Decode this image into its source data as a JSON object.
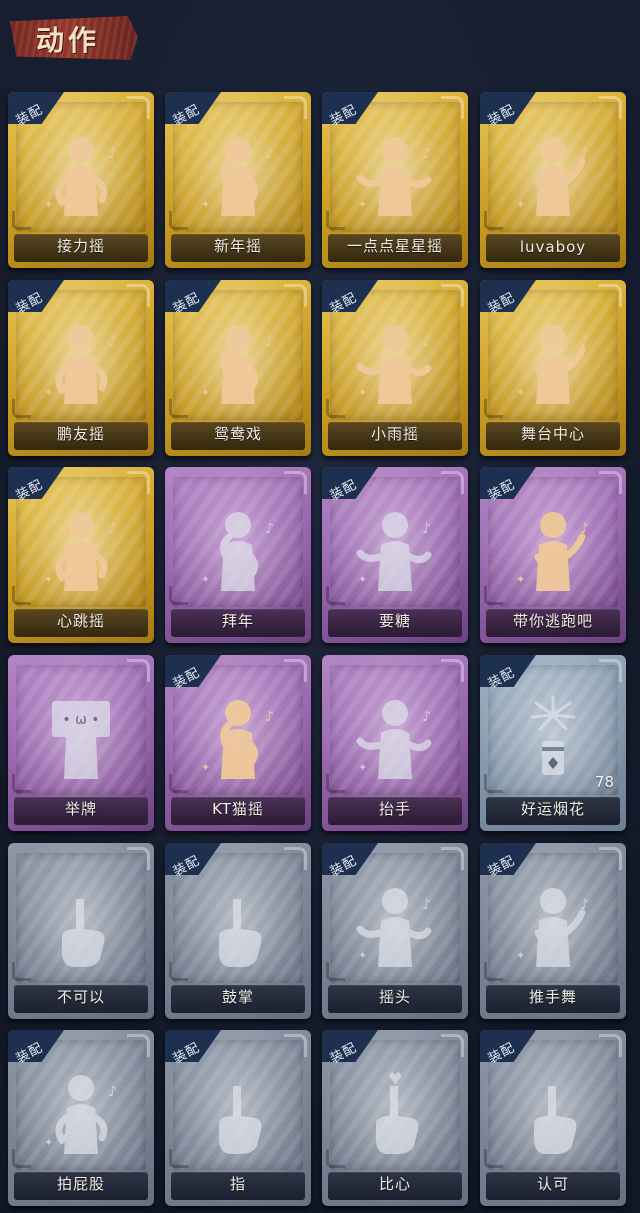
{
  "page": {
    "title": "动作"
  },
  "colors": {
    "gold": "#d4a930",
    "purple": "#9c6bb2",
    "silver": "#7b8596",
    "bluegray": "#8799ad",
    "equip_badge": "#1e3050",
    "figure_gold": "#f0c99a",
    "figure_faded": "#dfe3ea"
  },
  "equip_label": "装配",
  "cards": [
    {
      "label": "接力摇",
      "rarity": "gold",
      "equipped": true,
      "icon": "figure-dance-icon"
    },
    {
      "label": "新年摇",
      "rarity": "gold",
      "equipped": true,
      "icon": "figure-dance-icon"
    },
    {
      "label": "一点点星星摇",
      "rarity": "gold",
      "equipped": true,
      "icon": "figure-dance-icon"
    },
    {
      "label": "luvaboy",
      "rarity": "gold",
      "equipped": true,
      "icon": "figure-dance-icon"
    },
    {
      "label": "鹏友摇",
      "rarity": "gold",
      "equipped": true,
      "icon": "figure-dance-icon"
    },
    {
      "label": "鸳鸯戏",
      "rarity": "gold",
      "equipped": true,
      "icon": "figure-dance-icon"
    },
    {
      "label": "小雨摇",
      "rarity": "gold",
      "equipped": true,
      "icon": "figure-dance-icon"
    },
    {
      "label": "舞台中心",
      "rarity": "gold",
      "equipped": true,
      "icon": "figure-dance-icon"
    },
    {
      "label": "心跳摇",
      "rarity": "gold",
      "equipped": true,
      "icon": "figure-dance-icon"
    },
    {
      "label": "拜年",
      "rarity": "purple",
      "equipped": false,
      "icon": "figure-bow-icon"
    },
    {
      "label": "要糖",
      "rarity": "purple",
      "equipped": true,
      "icon": "figure-reach-icon"
    },
    {
      "label": "带你逃跑吧",
      "rarity": "purple",
      "equipped": true,
      "icon": "figure-point-icon"
    },
    {
      "label": "举牌",
      "rarity": "purple",
      "equipped": false,
      "icon": "figure-sign-icon"
    },
    {
      "label": "KT猫摇",
      "rarity": "purple",
      "equipped": true,
      "icon": "figure-dance-icon"
    },
    {
      "label": "抬手",
      "rarity": "purple",
      "equipped": false,
      "icon": "figure-raise-hand-icon"
    },
    {
      "label": "好运烟花",
      "rarity": "bluegray",
      "equipped": true,
      "icon": "firework-icon",
      "count": "78"
    },
    {
      "label": "不可以",
      "rarity": "silver",
      "equipped": false,
      "icon": "finger-wag-icon"
    },
    {
      "label": "鼓掌",
      "rarity": "silver",
      "equipped": true,
      "icon": "clap-icon"
    },
    {
      "label": "摇头",
      "rarity": "silver",
      "equipped": true,
      "icon": "figure-shake-head-icon"
    },
    {
      "label": "推手舞",
      "rarity": "silver",
      "equipped": true,
      "icon": "figure-push-dance-icon"
    },
    {
      "label": "拍屁股",
      "rarity": "silver",
      "equipped": true,
      "icon": "figure-slap-icon"
    },
    {
      "label": "指",
      "rarity": "silver",
      "equipped": true,
      "icon": "point-hand-icon"
    },
    {
      "label": "比心",
      "rarity": "silver",
      "equipped": true,
      "icon": "finger-heart-icon"
    },
    {
      "label": "认可",
      "rarity": "silver",
      "equipped": true,
      "icon": "thumbs-up-icon"
    }
  ]
}
